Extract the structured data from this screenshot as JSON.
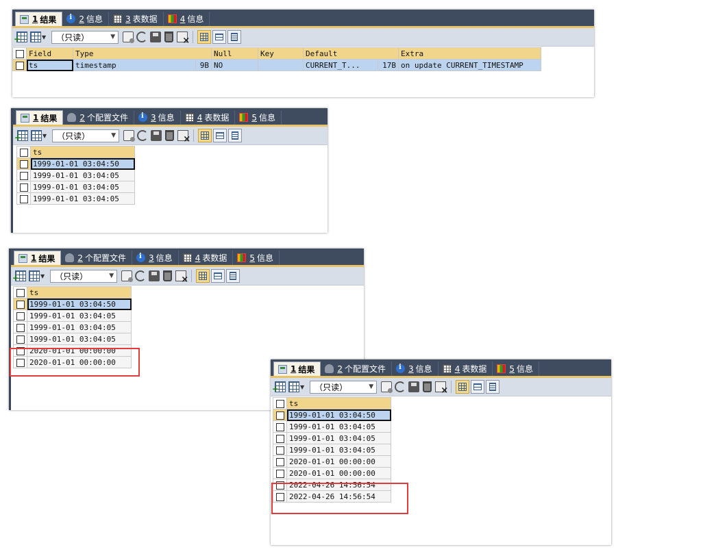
{
  "tabs_set_a": [
    {
      "num": "1",
      "label": "结果",
      "icon": "result-icon"
    },
    {
      "num": "2",
      "label": "信息",
      "icon": "info-icon"
    },
    {
      "num": "3",
      "label": "表数据",
      "icon": "table-data-icon"
    },
    {
      "num": "4",
      "label": "信息",
      "icon": "info-chart-icon"
    }
  ],
  "tabs_set_b": [
    {
      "num": "1",
      "label": "结果",
      "icon": "result-icon"
    },
    {
      "num": "2",
      "label": "个配置文件",
      "icon": "profile-icon"
    },
    {
      "num": "3",
      "label": "信息",
      "icon": "info-icon"
    },
    {
      "num": "4",
      "label": "表数据",
      "icon": "table-data-icon"
    },
    {
      "num": "5",
      "label": "信息",
      "icon": "info-chart-icon"
    }
  ],
  "toolbar": {
    "readonly_label": "（只读）"
  },
  "panel1": {
    "headers": [
      "Field",
      "Type",
      "Null",
      "Key",
      "Default",
      "Extra"
    ],
    "row": {
      "field": "ts",
      "type": "timestamp",
      "type_size": "9B",
      "null": "NO",
      "key": "",
      "default": "CURRENT_T...",
      "default_size": "17B",
      "extra": "on update CURRENT_TIMESTAMP"
    }
  },
  "column_header": "ts",
  "panel2_rows": [
    "1999-01-01 03:04:50",
    "1999-01-01 03:04:05",
    "1999-01-01 03:04:05",
    "1999-01-01 03:04:05"
  ],
  "panel3_rows": [
    "1999-01-01 03:04:50",
    "1999-01-01 03:04:05",
    "1999-01-01 03:04:05",
    "1999-01-01 03:04:05",
    "2020-01-01 00:00:00",
    "2020-01-01 00:00:00"
  ],
  "panel4_rows": [
    "1999-01-01 03:04:50",
    "1999-01-01 03:04:05",
    "1999-01-01 03:04:05",
    "1999-01-01 03:04:05",
    "2020-01-01 00:00:00",
    "2020-01-01 00:00:00",
    "2022-04-26 14:56:54",
    "2022-04-26 14:56:54"
  ],
  "colors": {
    "tabbar": "#3f4b5e",
    "toolbar": "#d8dee8",
    "header_cell": "#f0d58a",
    "selected_row": "#bcd4ef",
    "highlight_box": "#e23b3b"
  }
}
